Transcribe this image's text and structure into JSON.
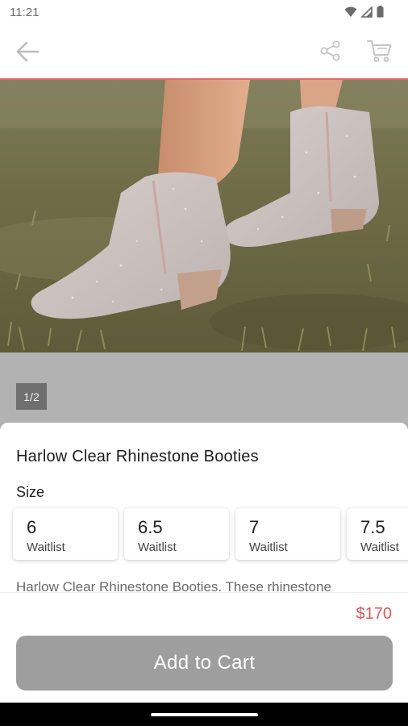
{
  "status_bar": {
    "time": "11:21",
    "icons": [
      "wifi-icon",
      "signal-icon",
      "battery-icon"
    ]
  },
  "top_bar": {
    "accent_color": "#e46a6a",
    "icons": [
      "arrow-left-icon",
      "share-icon",
      "cart-icon"
    ]
  },
  "gallery": {
    "pager": "1/2",
    "image_subject": "rhinestone-boots-photo"
  },
  "product": {
    "title": "Harlow Clear Rhinestone Booties",
    "size_label": "Size",
    "sizes": [
      {
        "value": "6",
        "status": "Waitlist"
      },
      {
        "value": "6.5",
        "status": "Waitlist"
      },
      {
        "value": "7",
        "status": "Waitlist"
      },
      {
        "value": "7.5",
        "status": "Waitlist"
      }
    ],
    "description": "Harlow Clear Rhinestone Booties. These rhinestone"
  },
  "purchase": {
    "price": "$170",
    "price_color": "#d85a5a",
    "add_to_cart_label": "Add to Cart"
  }
}
